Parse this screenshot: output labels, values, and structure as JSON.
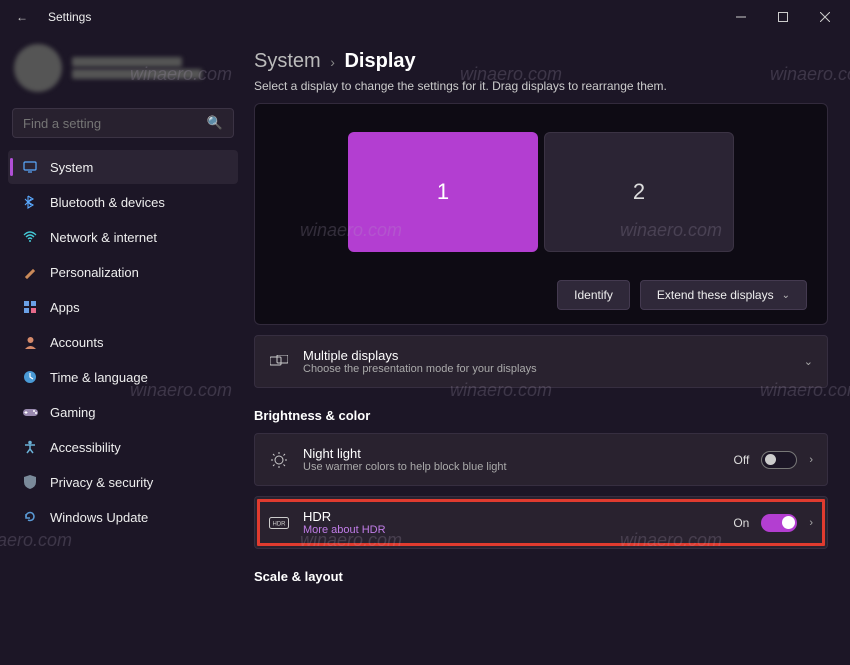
{
  "titlebar": {
    "title": "Settings"
  },
  "search": {
    "placeholder": "Find a setting"
  },
  "nav": {
    "items": [
      {
        "label": "System",
        "icon": "🖥"
      },
      {
        "label": "Bluetooth & devices",
        "icon": "bt"
      },
      {
        "label": "Network & internet",
        "icon": "wifi"
      },
      {
        "label": "Personalization",
        "icon": "✎"
      },
      {
        "label": "Apps",
        "icon": "▦"
      },
      {
        "label": "Accounts",
        "icon": "●"
      },
      {
        "label": "Time & language",
        "icon": "⏲"
      },
      {
        "label": "Gaming",
        "icon": "🎮"
      },
      {
        "label": "Accessibility",
        "icon": "♿"
      },
      {
        "label": "Privacy & security",
        "icon": "🛡"
      },
      {
        "label": "Windows Update",
        "icon": "↻"
      }
    ]
  },
  "breadcrumb": {
    "parent": "System",
    "current": "Display"
  },
  "subtitle": "Select a display to change the settings for it. Drag displays to rearrange them.",
  "monitors": {
    "m1": "1",
    "m2": "2",
    "identify": "Identify",
    "extend": "Extend these displays"
  },
  "multiple": {
    "title": "Multiple displays",
    "desc": "Choose the presentation mode for your displays"
  },
  "sections": {
    "brightness": "Brightness & color",
    "scale": "Scale & layout"
  },
  "nightlight": {
    "title": "Night light",
    "desc": "Use warmer colors to help block blue light",
    "state": "Off"
  },
  "hdr": {
    "title": "HDR",
    "link": "More about HDR",
    "state": "On"
  },
  "watermark": "winaero.com"
}
